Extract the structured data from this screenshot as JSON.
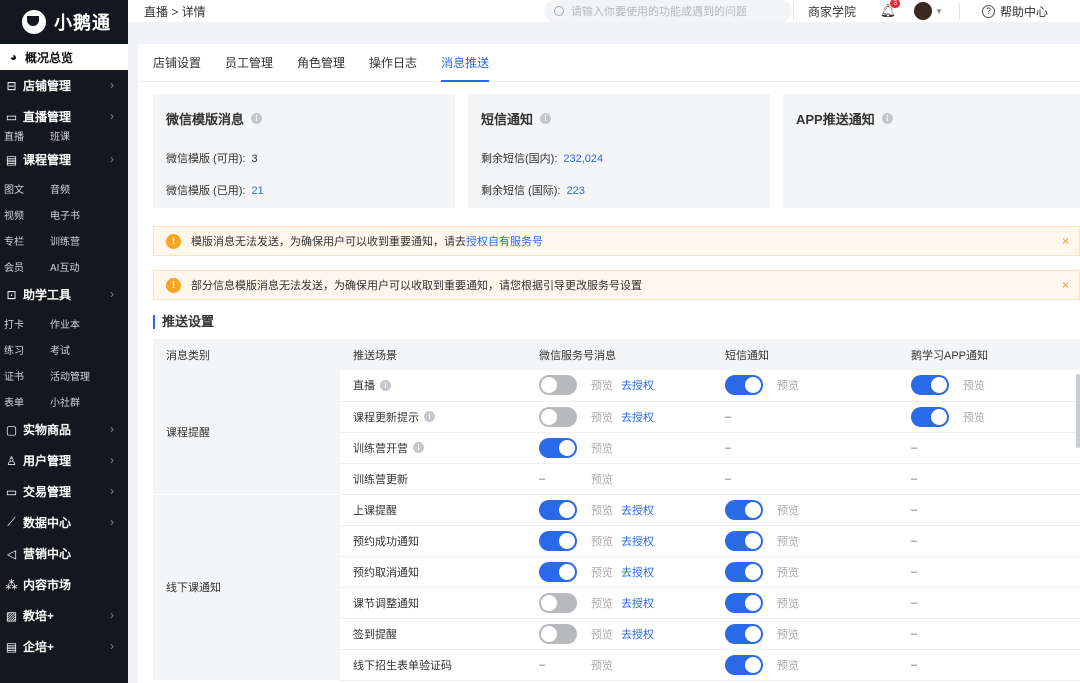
{
  "app": {
    "logo_text": "小鹅通"
  },
  "sidebar": {
    "overview": "概况总览",
    "items": [
      {
        "label": "店铺管理",
        "icon": "store-icon",
        "arrow": true
      },
      {
        "label": "直播管理",
        "icon": "live-icon",
        "arrow": true
      },
      {
        "label": "课程管理",
        "icon": "course-icon",
        "arrow": true
      },
      {
        "label": "助学工具",
        "icon": "toolbox-icon",
        "arrow": true
      },
      {
        "label": "实物商品",
        "icon": "goods-icon",
        "arrow": true
      },
      {
        "label": "用户管理",
        "icon": "user-icon",
        "arrow": true
      },
      {
        "label": "交易管理",
        "icon": "trade-icon",
        "arrow": true
      },
      {
        "label": "数据中心",
        "icon": "data-icon",
        "arrow": true
      },
      {
        "label": "营销中心",
        "icon": "marketing-icon",
        "arrow": false
      },
      {
        "label": "内容市场",
        "icon": "market-icon",
        "arrow": false
      },
      {
        "label": "教培+",
        "icon": "edu-icon",
        "arrow": true
      },
      {
        "label": "企培+",
        "icon": "enterprise-icon",
        "arrow": true
      }
    ],
    "sub_live": [
      "直播",
      "班课"
    ],
    "sub_course": [
      [
        "图文",
        "音频"
      ],
      [
        "视频",
        "电子书"
      ],
      [
        "专栏",
        "训练营"
      ],
      [
        "会员",
        "AI互动"
      ]
    ],
    "sub_tools": [
      [
        "打卡",
        "作业本"
      ],
      [
        "练习",
        "考试"
      ],
      [
        "证书",
        "活动管理"
      ],
      [
        "表单",
        "小社群"
      ]
    ]
  },
  "topbar": {
    "breadcrumb": "直播 > 详情",
    "search_placeholder": "请输入你要使用的功能或遇到的问题",
    "academy": "商家学院",
    "bell_badge": "3",
    "help": "帮助中心"
  },
  "tabs": [
    "店铺设置",
    "员工管理",
    "角色管理",
    "操作日志",
    "消息推送"
  ],
  "active_tab": "消息推送",
  "cards": {
    "wechat": {
      "title": "微信模版消息",
      "row1_label": "微信模版 (可用):",
      "row1_value": "3",
      "row2_label": "微信模版 (已用):",
      "row2_value": "21"
    },
    "sms": {
      "title": "短信通知",
      "row1_label": "剩余短信(国内):",
      "row1_value": "232,024",
      "row2_label": "剩余短信 (国际):",
      "row2_value": "223"
    },
    "app": {
      "title": "APP推送通知"
    }
  },
  "alerts": {
    "a1_text": "模版消息无法发送，为确保用户可以收到重要通知，请去",
    "a1_link": "授权自有服务号",
    "a2_text": "部分信息模版消息无法发送，为确保用户可以收取到重要通知，请您根据引导更改服务号设置",
    "close": "×"
  },
  "push": {
    "section_title": "推送设置",
    "headers": [
      "消息类别",
      "推送场景",
      "微信服务号消息",
      "短信通知",
      "鹅学习APP通知"
    ],
    "preview_label": "预览",
    "auth_label": "去授权",
    "dash": "–",
    "groups": [
      {
        "name": "课程提醒",
        "rows": [
          {
            "scene": "直播",
            "info": true,
            "wechat": "off",
            "wechat_auth": true,
            "sms": "on",
            "app": "on"
          },
          {
            "scene": "课程更新提示",
            "info": true,
            "wechat": "off",
            "wechat_auth": true,
            "sms": "none",
            "app": "on"
          },
          {
            "scene": "训练营开营",
            "info": true,
            "wechat": "on",
            "wechat_auth": false,
            "sms": "none",
            "app": "none"
          },
          {
            "scene": "训练营更新",
            "info": false,
            "wechat": "none",
            "wechat_auth": false,
            "sms": "none",
            "app": "none"
          }
        ]
      },
      {
        "name": "线下课通知",
        "rows": [
          {
            "scene": "上课提醒",
            "info": false,
            "wechat": "on",
            "wechat_auth": true,
            "sms": "on",
            "app": "none"
          },
          {
            "scene": "预约成功通知",
            "info": false,
            "wechat": "on",
            "wechat_auth": true,
            "sms": "on",
            "app": "none"
          },
          {
            "scene": "预约取消通知",
            "info": false,
            "wechat": "on",
            "wechat_auth": true,
            "sms": "on",
            "app": "none"
          },
          {
            "scene": "课节调整通知",
            "info": false,
            "wechat": "off",
            "wechat_auth": true,
            "sms": "on",
            "app": "none"
          },
          {
            "scene": "签到提醒",
            "info": false,
            "wechat": "off",
            "wechat_auth": true,
            "sms": "on",
            "app": "none"
          },
          {
            "scene": "线下招生表单验证码",
            "info": false,
            "wechat": "none",
            "wechat_auth": false,
            "sms": "on",
            "app": "none"
          }
        ]
      }
    ]
  },
  "colors": {
    "accent": "#2a6ae9",
    "sidebar_bg": "#14171f",
    "toggle_off": "#b8b9bc",
    "warning": "#f5a623"
  }
}
